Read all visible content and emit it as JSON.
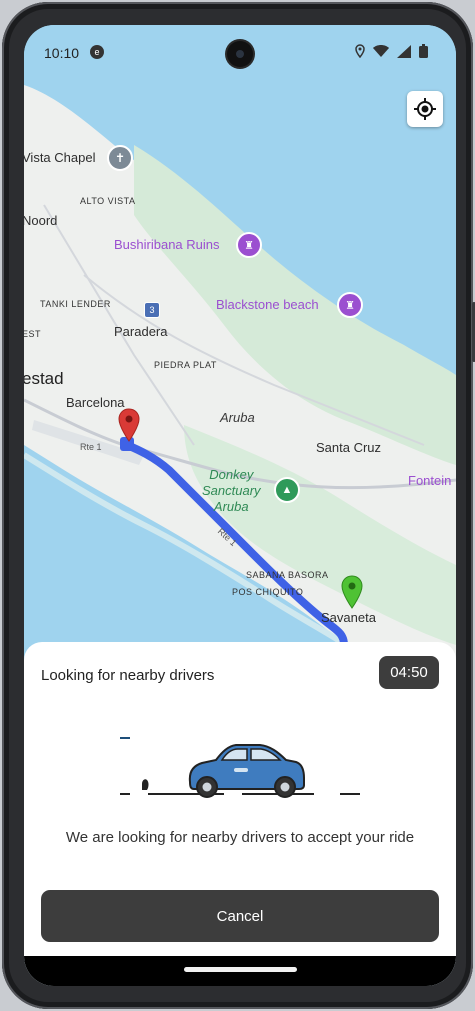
{
  "status": {
    "time": "10:10"
  },
  "map": {
    "places": {
      "vista_chapel": "Vista Chapel",
      "alto_vista": "ALTO VISTA",
      "noord": "Noord",
      "bushiribana": "Bushiribana Ruins",
      "tanki_lender": "TANKI LENDER",
      "route_number": "3",
      "blackstone": "Blackstone beach",
      "paradera": "Paradera",
      "est": "EST",
      "piedra_plat": "PIEDRA PLAT",
      "oranjestad": "estad",
      "barcelona": "Barcelona",
      "aruba": "Aruba",
      "santa_cruz": "Santa Cruz",
      "fontein": "Fontein",
      "donkey_line1": "Donkey",
      "donkey_line2": "Sanctuary",
      "donkey_line3": "Aruba",
      "sabana_basora": "SABANA BASORA",
      "pos_chiquito": "POS CHIQUITO",
      "savaneta": "Savaneta",
      "rte1": "Rte 1",
      "road_label": "Rte 1"
    },
    "colors": {
      "route": "#3f62e6",
      "origin_pin": "#d93a36",
      "destination_pin": "#4fc234"
    }
  },
  "sheet": {
    "title": "Looking for nearby drivers",
    "timer": "04:50",
    "message": "We are looking for nearby drivers to accept your ride",
    "cancel_label": "Cancel"
  }
}
